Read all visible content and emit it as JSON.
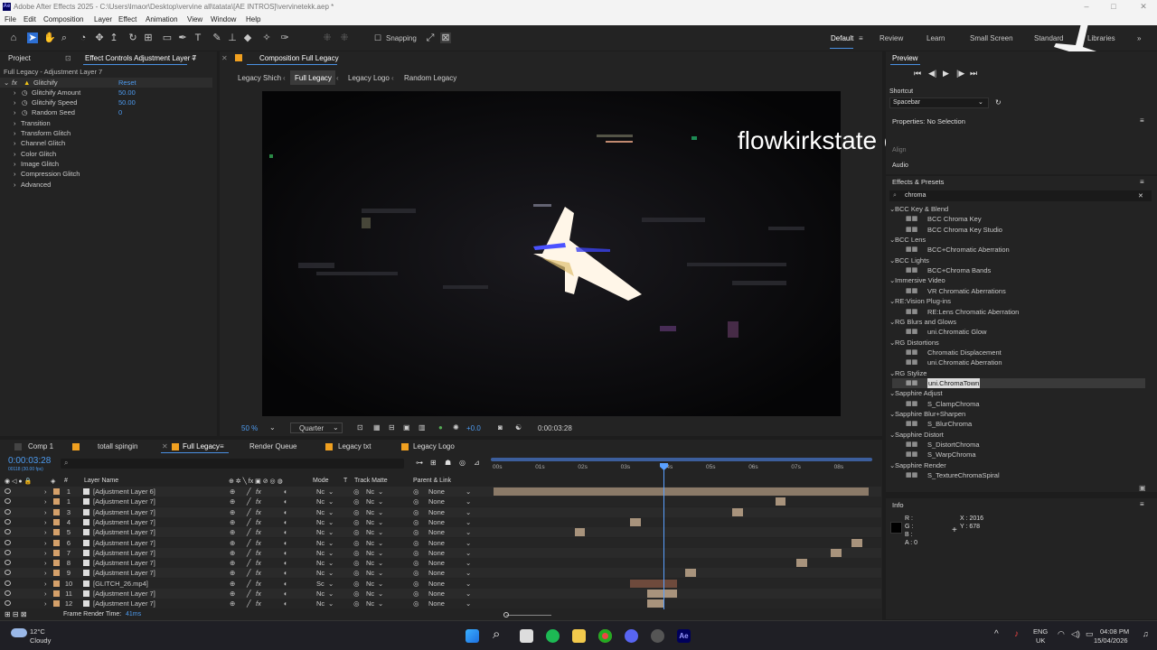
{
  "window": {
    "title": "Adobe After Effects 2025 - C:\\Users\\lmaor\\Desktop\\vervine all\\tatata\\[AE INTROS]\\vervinetekk.aep *"
  },
  "menu": [
    "File",
    "Edit",
    "Composition",
    "Layer",
    "Effect",
    "Animation",
    "View",
    "Window",
    "Help"
  ],
  "toolbar": {
    "snapping_label": "Snapping",
    "workspaces": [
      "Default",
      "Review",
      "Learn",
      "Small Screen",
      "Standard",
      "Libraries"
    ]
  },
  "project_panel": {
    "tab_project": "Project",
    "tab_effect_controls": "Effect Controls Adjustment Layer 7",
    "header": "Full Legacy - Adjustment Layer 7",
    "effect": {
      "name": "Glitchify",
      "reset": "Reset"
    },
    "properties": [
      {
        "label": "Glitchify Amount",
        "value": "50.00"
      },
      {
        "label": "Glitchify Speed",
        "value": "50.00"
      },
      {
        "label": "Random Seed",
        "value": "0"
      }
    ],
    "groups": [
      "Transition",
      "Transform Glitch",
      "Channel Glitch",
      "Color Glitch",
      "Image Glitch",
      "Compression Glitch",
      "Advanced"
    ]
  },
  "composition": {
    "tab": "Composition Full Legacy",
    "flow": [
      "Legacy Shich",
      "Full Legacy",
      "Legacy Logo",
      "Random Legacy"
    ],
    "overlay_text": "flowkirkstate chicken fried rice",
    "zoom": "50 %",
    "resolution": "Quarter",
    "exposure": "+0.0",
    "timecode": "0:00:03:28"
  },
  "timeline": {
    "tabs": [
      "Comp 1",
      "totall spingin",
      "Full Legacy",
      "Render Queue",
      "Legacy txt",
      "Legacy Logo"
    ],
    "current_time": "0:00:03:28",
    "current_time_sub": "00118 (30.00 fps)",
    "columns": {
      "name": "Layer Name",
      "mode": "Mode",
      "t": "T",
      "track_matte": "Track Matte",
      "parent": "Parent & Link"
    },
    "ruler": [
      "00s",
      "01s",
      "02s",
      "03s",
      "04s",
      "05s",
      "06s",
      "07s",
      "08s"
    ],
    "layers": [
      {
        "num": "1",
        "name": "[Adjustment Layer 6]",
        "mode": "Nc",
        "tm": "Nc",
        "parent": "None",
        "start": 0.0,
        "end": 8.8
      },
      {
        "num": "1",
        "name": "[Adjustment Layer 7]",
        "mode": "Nc",
        "tm": "Nc",
        "parent": "None",
        "start": 6.6,
        "end": 6.85
      },
      {
        "num": "3",
        "name": "[Adjustment Layer 7]",
        "mode": "Nc",
        "tm": "Nc",
        "parent": "None",
        "start": 5.6,
        "end": 5.85
      },
      {
        "num": "4",
        "name": "[Adjustment Layer 7]",
        "mode": "Nc",
        "tm": "Nc",
        "parent": "None",
        "start": 3.2,
        "end": 3.45
      },
      {
        "num": "5",
        "name": "[Adjustment Layer 7]",
        "mode": "Nc",
        "tm": "Nc",
        "parent": "None",
        "start": 1.9,
        "end": 2.15
      },
      {
        "num": "6",
        "name": "[Adjustment Layer 7]",
        "mode": "Nc",
        "tm": "Nc",
        "parent": "None",
        "start": 8.4,
        "end": 8.65
      },
      {
        "num": "7",
        "name": "[Adjustment Layer 7]",
        "mode": "Nc",
        "tm": "Nc",
        "parent": "None",
        "start": 7.9,
        "end": 8.15
      },
      {
        "num": "8",
        "name": "[Adjustment Layer 7]",
        "mode": "Nc",
        "tm": "Nc",
        "parent": "None",
        "start": 7.1,
        "end": 7.35
      },
      {
        "num": "9",
        "name": "[Adjustment Layer 7]",
        "mode": "Nc",
        "tm": "Nc",
        "parent": "None",
        "start": 4.5,
        "end": 4.75
      },
      {
        "num": "10",
        "name": "[GLITCH_26.mp4]",
        "mode": "Sc",
        "tm": "Nc",
        "parent": "None",
        "start": 3.2,
        "end": 4.3
      },
      {
        "num": "11",
        "name": "[Adjustment Layer 7]",
        "mode": "Nc",
        "tm": "Nc",
        "parent": "None",
        "start": 3.6,
        "end": 4.3
      },
      {
        "num": "12",
        "name": "[Adjustment Layer 7]",
        "mode": "Nc",
        "tm": "Nc",
        "parent": "None",
        "start": 3.6,
        "end": 4.0
      }
    ],
    "frame_render_label": "Frame Render Time:",
    "frame_render_value": "41ms"
  },
  "preview": {
    "title": "Preview",
    "shortcut_label": "Shortcut",
    "shortcut_value": "Spacebar"
  },
  "properties_panel": {
    "title": "Properties: No Selection",
    "align": "Align",
    "audio": "Audio"
  },
  "effects_presets": {
    "title": "Effects & Presets",
    "search": "chroma",
    "tree": [
      {
        "cat": "BCC Key & Blend",
        "items": [
          "BCC Chroma Key",
          "BCC Chroma Key Studio"
        ]
      },
      {
        "cat": "BCC Lens",
        "items": [
          "BCC+Chromatic Aberration"
        ]
      },
      {
        "cat": "BCC Lights",
        "items": [
          "BCC+Chroma Bands"
        ]
      },
      {
        "cat": "Immersive Video",
        "items": [
          "VR Chromatic Aberrations"
        ]
      },
      {
        "cat": "RE:Vision Plug-ins",
        "items": [
          "RE:Lens Chromatic Aberration"
        ]
      },
      {
        "cat": "RG Blurs and Glows",
        "items": [
          "uni.Chromatic Glow"
        ]
      },
      {
        "cat": "RG Distortions",
        "items": [
          "Chromatic Displacement",
          "uni.Chromatic Aberration"
        ]
      },
      {
        "cat": "RG Stylize",
        "items": [
          "uni.ChromaTown"
        ]
      },
      {
        "cat": "Sapphire Adjust",
        "items": [
          "S_ClampChroma"
        ]
      },
      {
        "cat": "Sapphire Blur+Sharpen",
        "items": [
          "S_BlurChroma"
        ]
      },
      {
        "cat": "Sapphire Distort",
        "items": [
          "S_DistortChroma",
          "S_WarpChroma"
        ]
      },
      {
        "cat": "Sapphire Render",
        "items": [
          "S_TextureChromaSpiral"
        ]
      }
    ],
    "selected": "uni.ChromaTown"
  },
  "info": {
    "title": "Info",
    "r": "R :",
    "g": "G :",
    "b": "B :",
    "a": "A : 0",
    "x": "X : 2016",
    "y": "Y : 678"
  },
  "taskbar": {
    "temp": "12°C",
    "weather": "Cloudy",
    "lang1": "ENG",
    "lang2": "UK",
    "time": "04:08 PM",
    "date": "15/04/2026"
  },
  "colors": {
    "accent_blue": "#4a90e2",
    "label_tan": "#d4a06a",
    "playhead": "#5aa0ff"
  }
}
